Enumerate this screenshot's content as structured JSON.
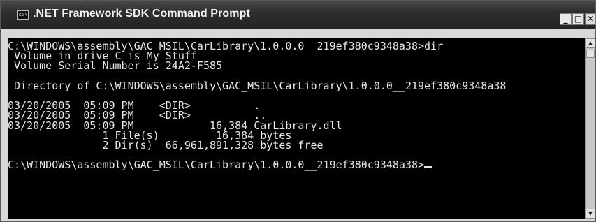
{
  "window": {
    "title": ".NET Framework SDK Command Prompt",
    "icon_text": "c:\\",
    "buttons": {
      "minimize": "_",
      "maximize": "□",
      "close": "✕"
    }
  },
  "console": {
    "lines": [
      "C:\\WINDOWS\\assembly\\GAC_MSIL\\CarLibrary\\1.0.0.0__219ef380c9348a38>dir",
      " Volume in drive C is My Stuff",
      " Volume Serial Number is 24A2-F585",
      "",
      " Directory of C:\\WINDOWS\\assembly\\GAC_MSIL\\CarLibrary\\1.0.0.0__219ef380c9348a38",
      "",
      "03/20/2005  05:09 PM    <DIR>          .",
      "03/20/2005  05:09 PM    <DIR>          ..",
      "03/20/2005  05:09 PM            16,384 CarLibrary.dll",
      "               1 File(s)         16,384 bytes",
      "               2 Dir(s)  66,961,891,328 bytes free",
      ""
    ],
    "prompt": "C:\\WINDOWS\\assembly\\GAC_MSIL\\CarLibrary\\1.0.0.0__219ef380c9348a38>"
  },
  "scrollbar": {
    "up_arrow": "▲",
    "down_arrow": "▼"
  }
}
